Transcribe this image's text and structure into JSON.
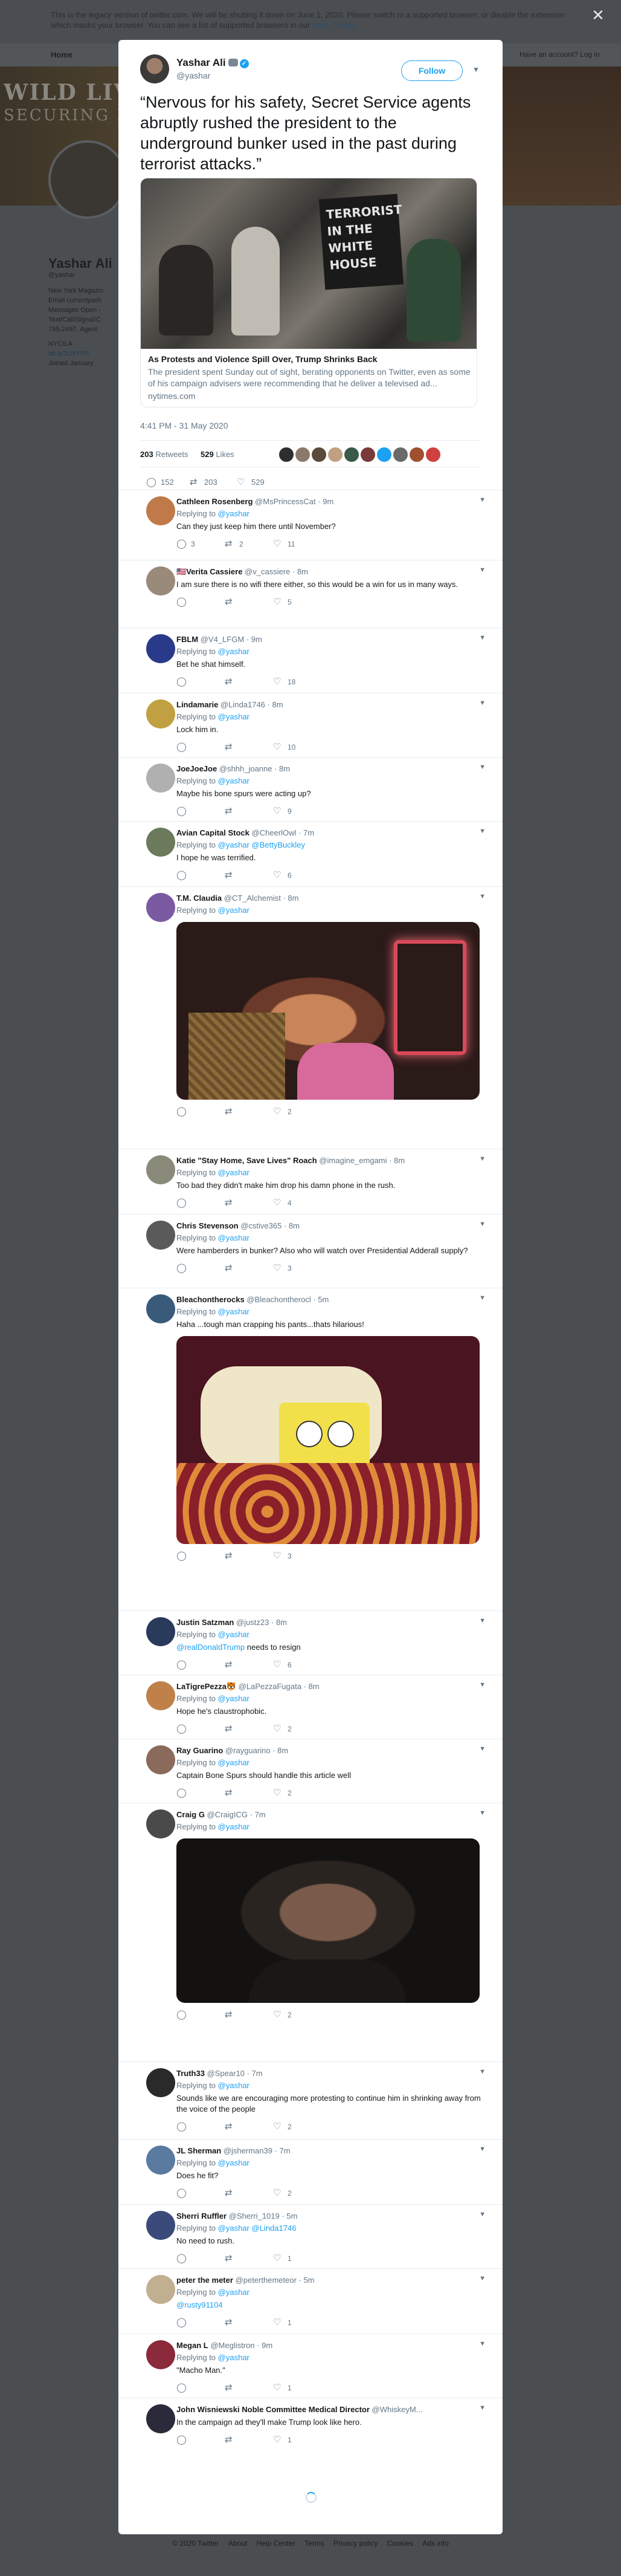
{
  "legacy_banner": {
    "text": "This is the legacy version of twitter.com. We will be shutting it down on June 1, 2020. Please switch to a supported browser, or disable the extension which masks your browser. You can see a list of supported browsers in our",
    "link": "Help Center",
    "end": "."
  },
  "background": {
    "nav_home": "Home",
    "nav_search_hint": "Search",
    "nav_right": "Have an account? Log in",
    "cover_brand_1": "WILD LIVES",
    "cover_brand_2": "SECURING HABIT",
    "profile_name": "Yashar Ali",
    "profile_handle": "@yashar",
    "profile_lines": [
      "New York Magazin",
      "Email currentyash",
      "Messages Open -",
      "Text/Call/Signal/C",
      "795-2497. Agent:"
    ],
    "profile_location": "NYC/LA",
    "profile_link": "bit.ly/2U8YPS",
    "profile_joined": "Joined January"
  },
  "tweet": {
    "author_name": "Yashar Ali",
    "author_handle": "@yashar",
    "follow_label": "Follow",
    "text": "“Nervous for his safety, Secret Service agents abruptly rushed the president to the underground bunker used in the past during terrorist attacks.”",
    "card": {
      "sign_text": "TERRORIST IN THE WHITE HOUSE",
      "title": "As Protests and Violence Spill Over, Trump Shrinks Back",
      "description": "The president spent Sunday out of sight, berating opponents on Twitter, even as some of his campaign advisers were recommending that he deliver a televised ad...",
      "domain": "nytimes.com"
    },
    "timestamp": "4:41 PM - 31 May 2020",
    "retweets_count": "203",
    "retweets_label": "Retweets",
    "likes_count": "529",
    "likes_label": "Likes",
    "liker_colors": [
      "#2e2e2e",
      "#8a7a6a",
      "#5a4a3a",
      "#c0a080",
      "#3a5a4a",
      "#7a3a3a",
      "#1da1f2",
      "#6a6a6a",
      "#a05030",
      "#d04040"
    ],
    "actions": {
      "replies": "152",
      "retweets": "203",
      "likes": "529"
    }
  },
  "replies": [
    {
      "name": "Cathleen Rosenberg",
      "handle": "@MsPrincessCat",
      "time": "9m",
      "replying_prefix": "Replying to",
      "replying_to": "@yashar",
      "text": "Can they just keep him there until November?",
      "reply_count": "3",
      "rt_count": "2",
      "like_count": "11",
      "avatar_color": "#c07a4a"
    },
    {
      "name": "Verita Cassiere",
      "name_prefix": "🇺🇸",
      "handle": "@v_cassiere",
      "time": "8m",
      "text": "I am sure there is no wifi there either, so this would be a win for us in many ways.",
      "reply_count": "",
      "rt_count": "",
      "like_count": "5",
      "avatar_color": "#9a8a7a"
    },
    {
      "name": "FBLM",
      "handle": "@V4_LFGM",
      "time": "9m",
      "replying_prefix": "Replying to",
      "replying_to": "@yashar",
      "text": "Bet he shat himself.",
      "reply_count": "",
      "rt_count": "",
      "like_count": "18",
      "avatar_color": "#2a3a8a"
    },
    {
      "name": "Lindamarie",
      "handle": "@Linda1746",
      "time": "8m",
      "replying_prefix": "Replying to",
      "replying_to": "@yashar",
      "text": "Lock him in.",
      "reply_count": "",
      "rt_count": "",
      "like_count": "10",
      "avatar_color": "#c0a040"
    },
    {
      "name": "JoeJoeJoe",
      "handle": "@shhh_joanne",
      "time": "8m",
      "replying_prefix": "Replying to",
      "replying_to": "@yashar",
      "text": "Maybe his bone spurs were acting up?",
      "reply_count": "",
      "rt_count": "",
      "like_count": "9",
      "avatar_color": "#b0b0b0"
    },
    {
      "name": "Avian Capital Stock",
      "handle": "@CheerlOwl",
      "time": "7m",
      "replying_prefix": "Replying to",
      "replying_to": "@yashar @BettyBuckley",
      "text": "I hope he was terrified.",
      "reply_count": "",
      "rt_count": "",
      "like_count": "6",
      "avatar_color": "#6a7a5a"
    },
    {
      "name": "T.M. Claudia",
      "handle": "@CT_Alchemist",
      "time": "8m",
      "replying_prefix": "Replying to",
      "replying_to": "@yashar",
      "text": "",
      "reply_count": "",
      "rt_count": "",
      "like_count": "2",
      "avatar_color": "#7a5aa0",
      "media": "gif1"
    },
    {
      "name": "Katie \"Stay Home, Save Lives\" Roach",
      "handle": "@imagine_emgami",
      "time": "8m",
      "replying_prefix": "Replying to",
      "replying_to": "@yashar",
      "text": "Too bad they didn't make him drop his damn phone in the rush.",
      "reply_count": "",
      "rt_count": "",
      "like_count": "4",
      "avatar_color": "#8a8a7a"
    },
    {
      "name": "Chris Stevenson",
      "handle": "@cstive365",
      "time": "8m",
      "replying_prefix": "Replying to",
      "replying_to": "@yashar",
      "text": "Were hamberders in bunker? Also who will watch over Presidential Adderall supply?",
      "reply_count": "",
      "rt_count": "",
      "like_count": "3",
      "avatar_color": "#5a5a5a"
    },
    {
      "name": "Bleachontherocks",
      "handle": "@Bleachontherocl",
      "time": "5m",
      "replying_prefix": "Replying to",
      "replying_to": "@yashar",
      "text": "Haha ...tough man crapping his pants...thats hilarious!",
      "reply_count": "",
      "rt_count": "",
      "like_count": "3",
      "avatar_color": "#3a5a7a",
      "media": "gif2"
    },
    {
      "name": "Justin Satzman",
      "handle": "@justz23",
      "time": "8m",
      "replying_prefix": "Replying to",
      "replying_to": "@yashar",
      "text_mention": "@realDonaldTrump",
      "text": "needs to resign",
      "reply_count": "",
      "rt_count": "",
      "like_count": "6",
      "avatar_color": "#2a3a5a"
    },
    {
      "name": "LaTigrePezza",
      "name_suffix": "🐯",
      "handle": "@LaPezzaFugata",
      "time": "8m",
      "replying_prefix": "Replying to",
      "replying_to": "@yashar",
      "text": "Hope he's claustrophobic.",
      "reply_count": "",
      "rt_count": "",
      "like_count": "2",
      "avatar_color": "#c0804a"
    },
    {
      "name": "Ray Guarino",
      "handle": "@rayguarino",
      "time": "8m",
      "replying_prefix": "Replying to",
      "replying_to": "@yashar",
      "text": "Captain Bone Spurs should handle this article well",
      "reply_count": "",
      "rt_count": "",
      "like_count": "2",
      "avatar_color": "#8a6a5a"
    },
    {
      "name": "Craig G",
      "handle": "@CraigICG",
      "time": "7m",
      "replying_prefix": "Replying to",
      "replying_to": "@yashar",
      "text": "",
      "reply_count": "",
      "rt_count": "",
      "like_count": "2",
      "avatar_color": "#4a4a4a",
      "media": "gif3"
    },
    {
      "name": "Truth33",
      "handle": "@Spear10",
      "time": "7m",
      "replying_prefix": "Replying to",
      "replying_to": "@yashar",
      "text": "Sounds like we are encouraging more protesting to continue him in shrinking away from the voice of the people",
      "reply_count": "",
      "rt_count": "",
      "like_count": "2",
      "avatar_color": "#2a2a2a"
    },
    {
      "name": "JL Sherman",
      "handle": "@jsherman39",
      "time": "7m",
      "replying_prefix": "Replying to",
      "replying_to": "@yashar",
      "text": "Does he fit?",
      "reply_count": "",
      "rt_count": "",
      "like_count": "2",
      "avatar_color": "#5a7aa0"
    },
    {
      "name": "Sherri Ruffler",
      "handle": "@Sherri_1019",
      "time": "5m",
      "replying_prefix": "Replying to",
      "replying_to": "@yashar @Linda1746",
      "text": "No need to rush.",
      "reply_count": "",
      "rt_count": "",
      "like_count": "1",
      "avatar_color": "#3a4a7a"
    },
    {
      "name": "peter the meter",
      "handle": "@peterthemeteor",
      "time": "5m",
      "replying_prefix": "Replying to",
      "replying_to": "@yashar",
      "text_mention": "@rusty91104",
      "text": "",
      "reply_count": "",
      "rt_count": "",
      "like_count": "1",
      "avatar_color": "#c0b090"
    },
    {
      "name": "Megan L",
      "handle": "@Meglistron",
      "time": "9m",
      "replying_prefix": "Replying to",
      "replying_to": "@yashar",
      "text": "\"Macho Man.\"",
      "reply_count": "",
      "rt_count": "",
      "like_count": "1",
      "avatar_color": "#8a2a3a"
    },
    {
      "name": "John Wisniewski Noble Committee Medical Director",
      "handle": "@WhiskeyM...",
      "time": "",
      "replying_prefix": "",
      "replying_to": "",
      "text": "In the campaign ad they'll make Trump look like hero.",
      "reply_count": "",
      "rt_count": "",
      "like_count": "1",
      "avatar_color": "#2a2a3a"
    }
  ],
  "footer": [
    "© 2020 Twitter",
    "About",
    "Help Center",
    "Terms",
    "Privacy policy",
    "Cookies",
    "Ads info"
  ]
}
